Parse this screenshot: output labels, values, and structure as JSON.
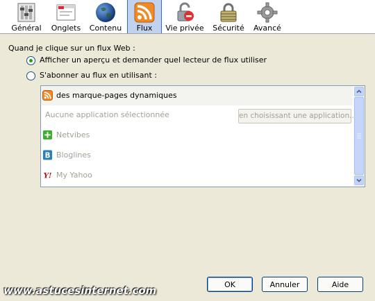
{
  "toolbar": {
    "tabs": [
      {
        "label": "Général",
        "icon": "switch-panel-icon"
      },
      {
        "label": "Onglets",
        "icon": "tabs-window-icon"
      },
      {
        "label": "Contenu",
        "icon": "globe-icon"
      },
      {
        "label": "Flux",
        "icon": "rss-feed-icon",
        "selected": true
      },
      {
        "label": "Vie privée",
        "icon": "privacy-lock-icon"
      },
      {
        "label": "Sécurité",
        "icon": "padlock-icon"
      },
      {
        "label": "Avancé",
        "icon": "gear-icon"
      }
    ]
  },
  "main": {
    "question": "Quand je clique sur un flux Web :",
    "options": [
      {
        "label": "Afficher un aperçu et demander quel lecteur de flux utiliser",
        "selected": true
      },
      {
        "label": "S'abonner au flux en utilisant :",
        "selected": false
      }
    ],
    "reader_list": {
      "items": [
        {
          "label": "des marque-pages dynamiques",
          "icon": "rss-feed-icon",
          "state": "header"
        },
        {
          "label": "Aucune application sélectionnée",
          "state": "disabled",
          "button": "en choisissant une application..."
        },
        {
          "label": "Netvibes",
          "icon": "netvibes-icon",
          "state": "disabled"
        },
        {
          "label": "Bloglines",
          "icon": "bloglines-icon",
          "state": "disabled"
        },
        {
          "label": "My Yahoo",
          "icon": "yahoo-icon",
          "state": "disabled"
        }
      ]
    }
  },
  "buttons": {
    "ok": "OK",
    "cancel": "Annuler",
    "help": "Aide"
  },
  "watermark": "www.astucesinternet.com",
  "colors": {
    "dialog_bg": "#ece9d8",
    "selected_tab": "#c1d2ee",
    "radio_dot": "#21a121",
    "rss_orange": "#f08a24"
  }
}
